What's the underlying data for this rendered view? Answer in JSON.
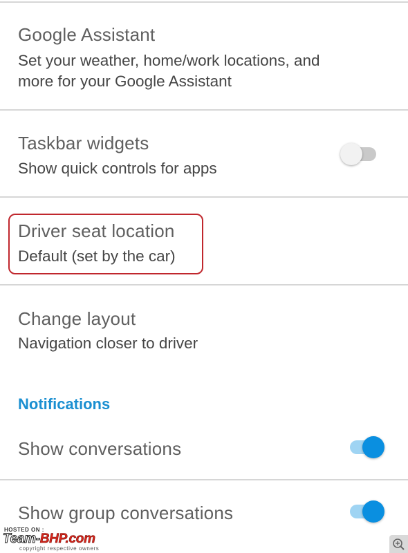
{
  "settings": {
    "google_assistant": {
      "title": "Google Assistant",
      "subtitle_line1": "Set your weather, home/work locations, and",
      "subtitle_line2": "more for your Google Assistant"
    },
    "taskbar_widgets": {
      "title": "Taskbar widgets",
      "subtitle": "Show quick controls for apps",
      "toggle_state": "off"
    },
    "driver_seat": {
      "title": "Driver seat location",
      "subtitle": "Default (set by the car)"
    },
    "change_layout": {
      "title": "Change layout",
      "subtitle": "Navigation closer to driver"
    }
  },
  "notifications": {
    "header": "Notifications",
    "show_conversations": {
      "title": "Show conversations",
      "toggle_state": "on"
    },
    "show_group_conversations": {
      "title": "Show group conversations",
      "toggle_state": "on"
    }
  },
  "watermark": {
    "hosted": "HOSTED ON :",
    "logo_part1": "Team-",
    "logo_part2": "BHP.com",
    "copyright": "copyright respective owners"
  },
  "icons": {
    "zoom": "zoom-in-icon"
  },
  "colors": {
    "accent": "#1a8fd1",
    "toggle_on": "#0a8fe0",
    "highlight": "#c0272d"
  }
}
